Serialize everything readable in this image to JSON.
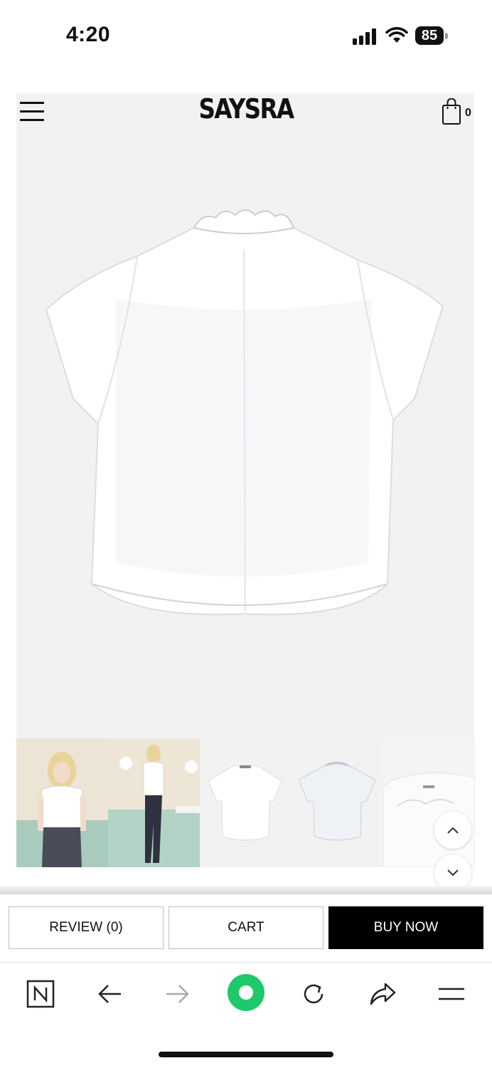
{
  "status_bar": {
    "time": "4:20",
    "battery": "85",
    "icons": [
      "signal-icon",
      "wifi-icon",
      "battery-icon"
    ]
  },
  "header": {
    "brand": "SAYSRA",
    "cart_count": "0",
    "icons": [
      "menu-icon",
      "shopping-bag-icon"
    ]
  },
  "product": {
    "main_image": "white short-sleeve shirt, back view",
    "thumbnails": [
      {
        "desc": "model front view"
      },
      {
        "desc": "model side view"
      },
      {
        "desc": "shirt front flat"
      },
      {
        "desc": "shirt back flat"
      },
      {
        "desc": "collar detail"
      }
    ]
  },
  "actions": {
    "review_label": "REVIEW (0)",
    "cart_label": "CART",
    "buy_label": "BUY NOW"
  },
  "browser_toolbar": {
    "icons": [
      "naver-icon",
      "back-arrow-icon",
      "forward-arrow-icon",
      "green-circle-icon",
      "refresh-icon",
      "share-icon",
      "menu-lines-icon"
    ]
  },
  "colors": {
    "accent_green": "#1ec800",
    "buy_button": "#000000",
    "background": "#f2f2f2"
  }
}
